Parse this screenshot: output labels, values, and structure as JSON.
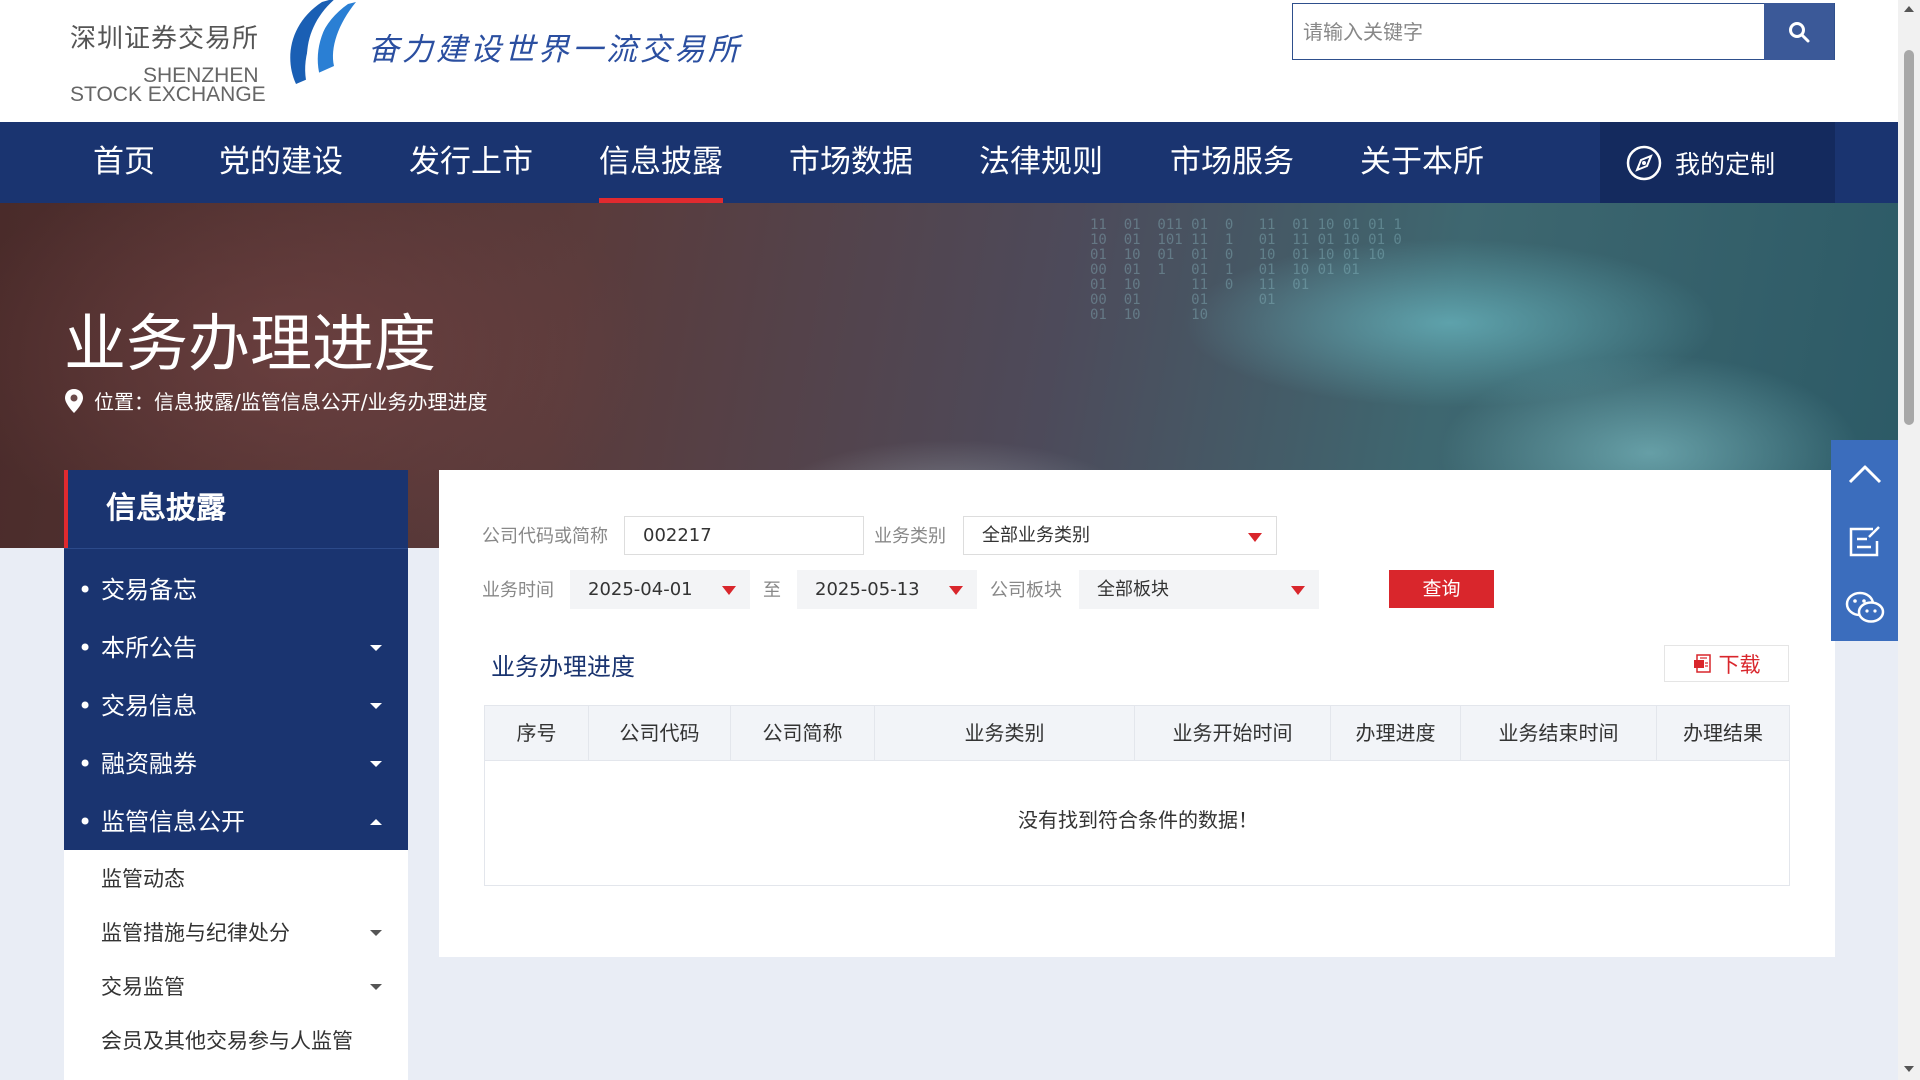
{
  "header": {
    "logo_cn": "深圳证券交易所",
    "logo_en_line1": "SHENZHEN",
    "logo_en_line2": "STOCK EXCHANGE",
    "slogan": "奋力建设世界一流交易所",
    "search_placeholder": "请输入关键字",
    "search_icon": "search-icon"
  },
  "nav": {
    "items": [
      "首页",
      "党的建设",
      "发行上市",
      "信息披露",
      "市场数据",
      "法律规则",
      "市场服务",
      "关于本所"
    ],
    "active": "信息披露",
    "custom_label": "我的定制",
    "custom_icon": "compass-icon"
  },
  "banner": {
    "title": "业务办理进度",
    "breadcrumb": "位置：信息披露/监管信息公开/业务办理进度",
    "location_icon": "location-pin-icon"
  },
  "sidebar": {
    "title": "信息披露",
    "items": [
      {
        "label": "交易备忘",
        "caret": "none"
      },
      {
        "label": "本所公告",
        "caret": "down"
      },
      {
        "label": "交易信息",
        "caret": "down"
      },
      {
        "label": "融资融券",
        "caret": "down"
      },
      {
        "label": "监管信息公开",
        "caret": "up"
      }
    ],
    "sub_items": [
      {
        "label": "监管动态",
        "caret": "none"
      },
      {
        "label": "监管措施与纪律处分",
        "caret": "down"
      },
      {
        "label": "交易监管",
        "caret": "down"
      },
      {
        "label": "会员及其他交易参与人监管",
        "caret": "none"
      }
    ]
  },
  "filters": {
    "company_label": "公司代码或简称",
    "company_value": "002217",
    "biz_type_label": "业务类别",
    "biz_type_value": "全部业务类别",
    "biz_time_label": "业务时间",
    "date_from": "2025-04-01",
    "to_label": "至",
    "date_to": "2025-05-13",
    "board_label": "公司板块",
    "board_value": "全部板块",
    "query_label": "查询"
  },
  "results": {
    "title": "业务办理进度",
    "download_label": "下载",
    "download_icon": "pdf-icon",
    "columns": [
      "序号",
      "公司代码",
      "公司简称",
      "业务类别",
      "业务开始时间",
      "办理进度",
      "业务结束时间",
      "办理结果"
    ],
    "empty_message": "没有找到符合条件的数据！"
  },
  "float_bar": {
    "icons": [
      "back-to-top-icon",
      "feedback-edit-icon",
      "wechat-icon"
    ]
  },
  "colors": {
    "nav_blue": "#1a3470",
    "accent_red": "#d9262c",
    "float_blue": "#3b6dbd"
  }
}
